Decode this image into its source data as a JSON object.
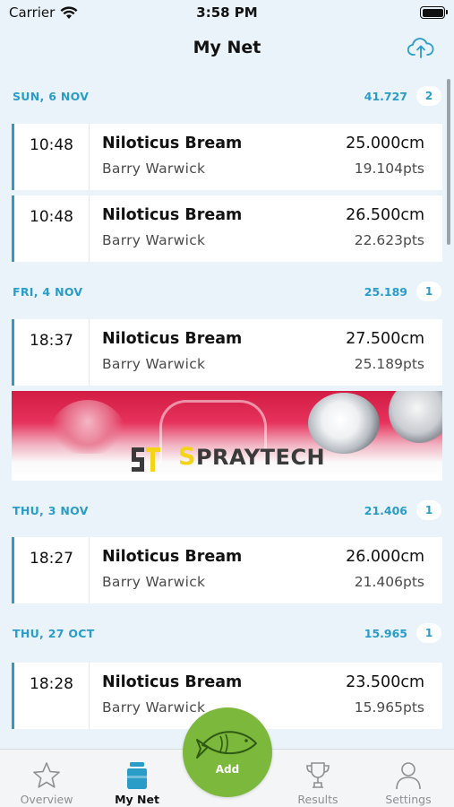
{
  "status": {
    "carrier": "Carrier",
    "time": "3:58 PM"
  },
  "nav": {
    "title": "My Net"
  },
  "sections": [
    {
      "date": "SUN, 6 NOV",
      "total": "41.727",
      "count": "2",
      "entries": [
        {
          "time": "10:48",
          "species": "Niloticus Bream",
          "length": "25.000cm",
          "angler": "Barry Warwick",
          "points": "19.104pts"
        },
        {
          "time": "10:48",
          "species": "Niloticus Bream",
          "length": "26.500cm",
          "angler": "Barry Warwick",
          "points": "22.623pts"
        }
      ]
    },
    {
      "date": "FRI, 4 NOV",
      "total": "25.189",
      "count": "1",
      "entries": [
        {
          "time": "18:37",
          "species": "Niloticus Bream",
          "length": "27.500cm",
          "angler": "Barry Warwick",
          "points": "25.189pts"
        }
      ]
    },
    {
      "date": "THU, 3 NOV",
      "total": "21.406",
      "count": "1",
      "entries": [
        {
          "time": "18:27",
          "species": "Niloticus Bream",
          "length": "26.000cm",
          "angler": "Barry Warwick",
          "points": "21.406pts"
        }
      ]
    },
    {
      "date": "THU, 27 OCT",
      "total": "15.965",
      "count": "1",
      "entries": [
        {
          "time": "18:28",
          "species": "Niloticus Bream",
          "length": "23.500cm",
          "angler": "Barry Warwick",
          "points": "15.965pts"
        }
      ]
    }
  ],
  "ad": {
    "brand_first": "S",
    "brand_rest": "PRAYTECH",
    "brand_color": "#f4d417"
  },
  "tabs": {
    "overview": "Overview",
    "mynet": "My Net",
    "add": "Add",
    "results": "Results",
    "settings": "Settings"
  },
  "colors": {
    "accent": "#2a9cc8",
    "fab": "#7cb83b",
    "background": "#eaf3f9"
  },
  "icons": {
    "upload": "cloud-upload-icon",
    "overview": "star-icon",
    "mynet": "jar-icon",
    "add": "fish-icon",
    "results": "trophy-icon",
    "settings": "person-icon"
  }
}
